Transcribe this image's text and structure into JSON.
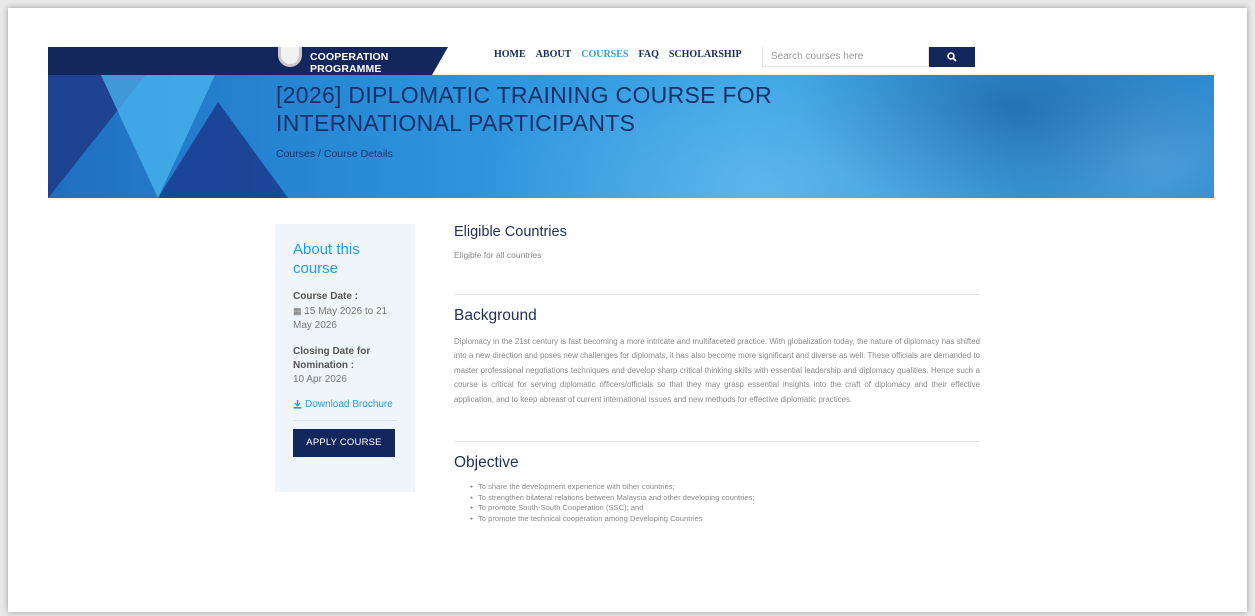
{
  "header": {
    "logo_text": "COOPERATION PROGRAMME",
    "nav": [
      "HOME",
      "ABOUT",
      "COURSES",
      "FAQ",
      "SCHOLARSHIP"
    ],
    "active_nav": "COURSES",
    "search_placeholder": "Search courses here"
  },
  "hero": {
    "title_line1": "[2026] DIPLOMATIC TRAINING COURSE FOR",
    "title_line2": "INTERNATIONAL PARTICIPANTS",
    "breadcrumb_courses": "Courses",
    "breadcrumb_sep": " / ",
    "breadcrumb_current": "Course Details"
  },
  "sidebar": {
    "heading": "About this course",
    "course_date_label": "Course Date :",
    "course_date_value": "15 May 2026 to 21 May 2026",
    "closing_label": "Closing Date for Nomination :",
    "closing_value": "10 Apr 2026",
    "download_label": "Download Brochure",
    "apply_label": "APPLY COURSE"
  },
  "main": {
    "eligible_title": "Eligible Countries",
    "eligible_text": "Eligible for all countries",
    "background_title": "Background",
    "background_text": "Diplomacy in the 21st century is fast becoming a more intricate and multifaceted practice. With globalization today, the nature of diplomacy has shifted into a new direction and poses new challenges for diplomats, it has also become more significant and diverse as well. These officials are demanded to master professional negotiations techniques and develop sharp critical thinking skills with essential leadership and diplomacy qualities. Hence such a course is critical for serving diplomatic officers/officials so that they may grasp essential insights into the craft of diplomacy and their effective application, and to keep abreast of current international issues and new methods for effective diplomatic practices.",
    "objective_title": "Objective",
    "objectives": [
      "To share the development experience with other countries;",
      "To strengthen bilateral relations between Malaysia and other developing countries;",
      "To promote South-South Cooperation (SSC); and",
      "To promote the technical cooperation among Developing Countries"
    ]
  },
  "colors": {
    "navy": "#14275c",
    "accent_blue": "#2b9ad6",
    "hero_blue": "#2a8fd9"
  },
  "icons": [
    "emblem-logo",
    "search-icon",
    "calendar-icon",
    "download-icon"
  ]
}
